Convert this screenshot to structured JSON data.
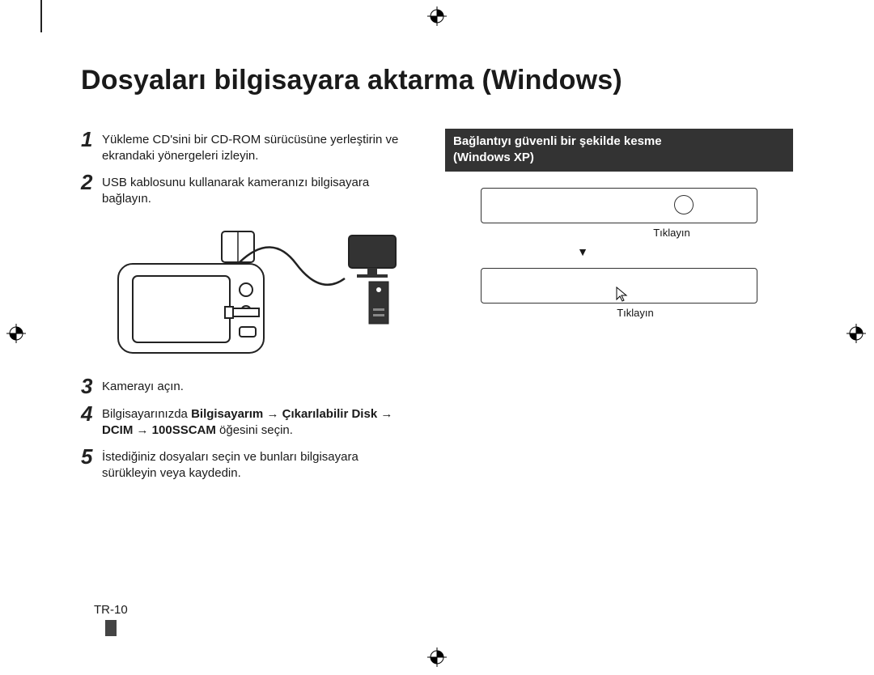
{
  "title": "Dosyaları bilgisayara aktarma (Windows)",
  "steps": {
    "s1": {
      "num": "1",
      "text": "Yükleme CD'sini bir CD-ROM sürücüsüne yerleştirin ve ekrandaki yönergeleri izleyin."
    },
    "s2": {
      "num": "2",
      "text": "USB kablosunu kullanarak kameranızı bilgisayara bağlayın."
    },
    "s3": {
      "num": "3",
      "text": "Kamerayı açın."
    },
    "s4": {
      "num": "4",
      "prefix": "Bilgisayarınızda ",
      "bold": "Bilgisayarım → Çıkarılabilir Disk → DCIM → 100SSCAM",
      "suffix": " öğesini seçin."
    },
    "s5": {
      "num": "5",
      "text": "İstediğiniz dosyaları seçin ve bunları bilgisayara sürükleyin veya kaydedin."
    }
  },
  "right": {
    "header_line1": "Bağlantıyı güvenli bir şekilde kesme",
    "header_line2": "(Windows XP)",
    "click1": "Tıklayın",
    "arrow": "▼",
    "click2": "Tıklayın"
  },
  "page_number": "TR-10"
}
